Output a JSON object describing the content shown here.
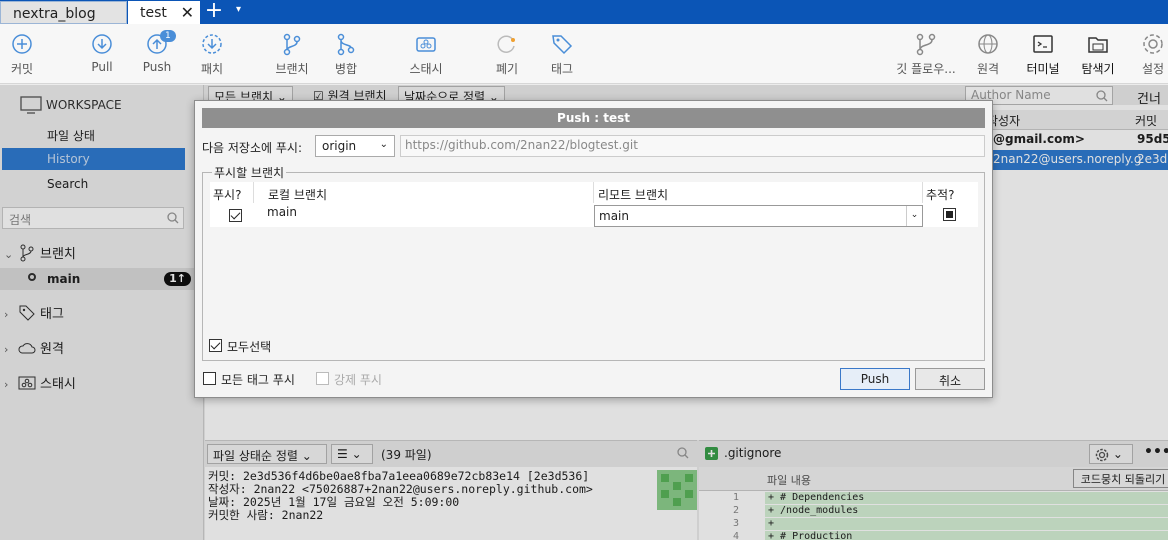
{
  "tabs": [
    {
      "label": "nextra_blog"
    },
    {
      "label": "test",
      "close": "✕"
    }
  ],
  "tabbar": {
    "add": "+",
    "menu": "▾"
  },
  "toolbar": {
    "commit": "커밋",
    "pull": "Pull",
    "push": "Push",
    "push_badge": "1",
    "fetch": "패치",
    "branch": "브랜치",
    "merge": "병합",
    "stash": "스태시",
    "discard": "폐기",
    "tag": "태그",
    "gitflow": "깃 플로우...",
    "remote": "원격",
    "terminal": "터미널",
    "explorer": "탐색기",
    "settings": "설정"
  },
  "sidebar": {
    "workspace": "WORKSPACE",
    "file_status": "파일 상태",
    "history": "History",
    "search": "Search",
    "search_placeholder": "검색",
    "branches": "브랜치",
    "main_branch": "main",
    "main_count": "1↑",
    "tags": "태그",
    "remotes": "원격",
    "stashes": "스태시"
  },
  "history": {
    "filter_all": "모든 브랜치",
    "filter_remote": "원격 브랜치",
    "sort": "날짜순으로 정렬",
    "author_placeholder": "Author Name",
    "skip": "건너뛰",
    "col_author": "작성자",
    "col_commit": "커밋",
    "row1_author": "@gmail.com>",
    "row1_commit": "95d5",
    "row2_author": "2nan22@users.noreply.g",
    "row2_commit": "2e3d"
  },
  "bottom_left": {
    "sort": "파일 상태순 정렬",
    "view": "☰",
    "file_count": "(39 파일)",
    "commit_line": "커밋: 2e3d536f4d6be0ae8fba7a1eea0689e72cb83e14 [2e3d536]",
    "author_line": "작성자: 2nan22 <75026887+2nan22@users.noreply.github.com>",
    "date_line": "날짜: 2025년 1월 17일 금요일 오전 5:09:00",
    "committer_line": "커밋한 사람: 2nan22"
  },
  "bottom_right": {
    "filename": ".gitignore",
    "file_content": "파일 내용",
    "revert": "코드뭉치 되돌리기",
    "more": "•••",
    "lines": [
      {
        "n": "1",
        "code": "+ # Dependencies"
      },
      {
        "n": "2",
        "code": "+ /node_modules"
      },
      {
        "n": "3",
        "code": "+"
      },
      {
        "n": "4",
        "code": "+ # Production"
      }
    ]
  },
  "dialog": {
    "title": "Push :  test",
    "push_to_label": "다음 저장소에 푸시:",
    "remote": "origin",
    "url": "https://github.com/2nan22/blogtest.git",
    "branches_legend": "푸시할 브랜치",
    "col_push": "푸시?",
    "col_local": "로컬 브랜치",
    "col_remote": "리모트 브랜치",
    "col_track": "추적?",
    "local_branch": "main",
    "remote_branch": "main",
    "select_all": "모두선택",
    "push_all_tags": "모든 태그 푸시",
    "force_push": "강제 푸시",
    "push_button": "Push",
    "cancel_button": "취소"
  },
  "colors": {
    "accent": "#2f7cd2",
    "tabbar": "#0b55b6",
    "diff_added": "#d6f1d6"
  }
}
